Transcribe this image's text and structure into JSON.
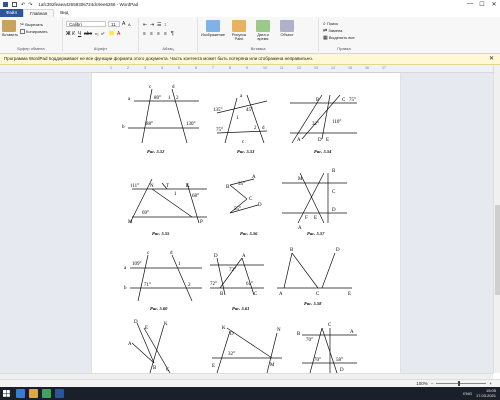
{
  "titlebar": {
    "title": "1afc392feaea42659306724dc9ee6266 - WordPad",
    "controls": [
      "—",
      "☐",
      "✕"
    ]
  },
  "tabs": [
    "Файл",
    "Главная",
    "Вид"
  ],
  "ribbon": {
    "clipboard": {
      "paste": "Вставить",
      "cut": "Вырезать",
      "copy": "Копировать",
      "label": "Буфер обмена"
    },
    "font": {
      "name": "Calibri",
      "size": "11",
      "label": "Шрифт"
    },
    "paragraph": {
      "label": "Абзац"
    },
    "insert": {
      "image": "Изображение",
      "paint": "Рисунок Paint",
      "datetime": "Дата и время",
      "object": "Объект",
      "label": "Вставка"
    },
    "editing": {
      "find": "Поиск",
      "replace": "Замена",
      "select_all": "Выделить все",
      "label": "Правка"
    }
  },
  "notice": {
    "text": "Программа WordPad поддерживает не все функции формата этого документа. Часть контента может быть потеряна или отображена неправильно.",
    "close": "✕"
  },
  "ruler": {
    "ticks": [
      "1",
      "2",
      "3",
      "4",
      "5",
      "6",
      "7",
      "8",
      "9",
      "10",
      "11",
      "12",
      "13",
      "14",
      "15",
      "16",
      "17"
    ]
  },
  "figures": {
    "f1": {
      "caption": "Рис. 5.52",
      "labels": [
        "c",
        "d",
        "a",
        "b",
        "80°",
        "1",
        "2",
        "88°",
        "130°"
      ]
    },
    "f2": {
      "caption": "Рис. 5.53",
      "labels": [
        "a",
        "135°",
        "45°",
        "1",
        "75°",
        "2",
        "c",
        "d"
      ]
    },
    "f3": {
      "caption": "Рис. 5.54",
      "labels": [
        "B",
        "C",
        "75°",
        "32°",
        "110°",
        "A",
        "D",
        "E"
      ]
    },
    "f4": {
      "caption": "Рис. 5.55",
      "labels": [
        "111°",
        "N",
        "T",
        "K",
        "1",
        "68°",
        "69°",
        "M",
        "P"
      ]
    },
    "f5": {
      "caption": "Рис. 5.56",
      "labels": [
        "A",
        "35°",
        "B",
        "C",
        "55°",
        "D"
      ]
    },
    "f6": {
      "caption": "Рис. 5.57",
      "labels": [
        "B",
        "M",
        "C",
        "F",
        "E",
        "A",
        "D"
      ]
    },
    "f7": {
      "caption": "Рис. 5.60",
      "labels": [
        "c",
        "d",
        "a",
        "109°",
        "1",
        "b",
        "71°",
        "2"
      ]
    },
    "f8": {
      "caption": "Рис. 5.61",
      "labels": [
        "D",
        "A",
        "72°",
        "72°",
        "61°",
        "B",
        "C"
      ]
    },
    "f9": {
      "caption": "Рис. 5.58",
      "labels": [
        "B",
        "D",
        "A",
        "C",
        "E"
      ]
    },
    "f10": {
      "labels": [
        "D",
        "E",
        "K",
        "A",
        "B",
        "C"
      ]
    },
    "f11": {
      "labels": [
        "K",
        "D",
        "N",
        "32°",
        "M",
        "E"
      ]
    },
    "f12": {
      "labels": [
        "C",
        "A",
        "70°",
        "B",
        "70°",
        "58°",
        "D"
      ]
    }
  },
  "status": {
    "zoom": "100%"
  },
  "taskbar": {
    "lang": "ENG",
    "time": "15:05",
    "date": "17.03.2021"
  },
  "colors": {
    "accent": "#2b579a",
    "notice_bg": "#fff7d6",
    "workspace": "#e6e9ef",
    "taskbar": "#1b1f2a"
  }
}
